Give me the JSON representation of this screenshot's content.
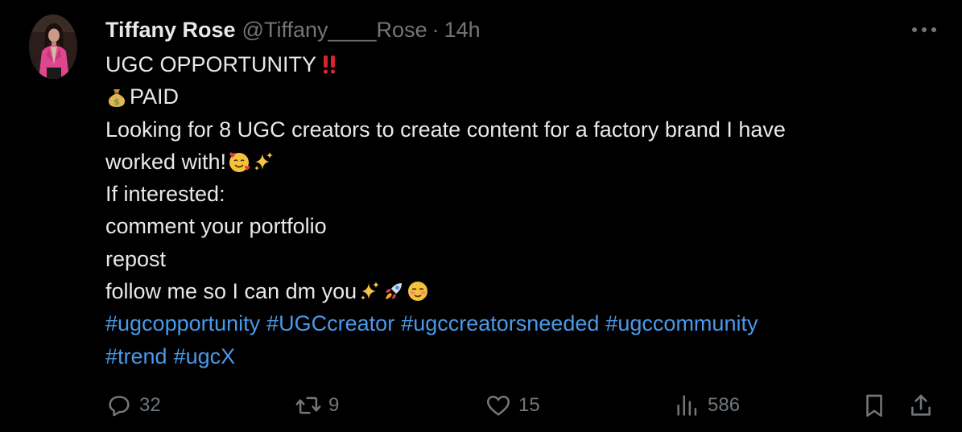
{
  "author": {
    "display_name": "Tiffany Rose",
    "handle": "@Tiffany____Rose",
    "separator": "·",
    "time": "14h"
  },
  "tweet": {
    "line1_text": "UGC OPPORTUNITY ",
    "line2_text": "PAID",
    "line3_text": "Looking for 8 UGC creators to create content for a factory brand I have",
    "line4_text": "worked with! ",
    "line5_text": "If interested:",
    "line6_text": "comment your portfolio",
    "line7_text": "repost",
    "line8_text": "follow me so I can dm you",
    "hashtags_line1": [
      "#ugcopportunity",
      "#UGCcreator",
      "#ugccreatorsneeded",
      "#ugccommunity"
    ],
    "hashtags_line2": [
      "#trend",
      "#ugcX"
    ]
  },
  "emoji": {
    "line1": "double-exclamation-mark",
    "line2": "money-bag",
    "line4": [
      "smiling-face-with-hearts",
      "sparkles"
    ],
    "line8": [
      "sparkles",
      "rocket",
      "smiling-face"
    ]
  },
  "actions": {
    "replies": "32",
    "reposts": "9",
    "likes": "15",
    "views": "586"
  },
  "colors": {
    "background": "#000000",
    "text": "#e7e9ea",
    "secondary": "#71767b",
    "link": "#4a99e9",
    "exclamation": "#d6242a"
  }
}
